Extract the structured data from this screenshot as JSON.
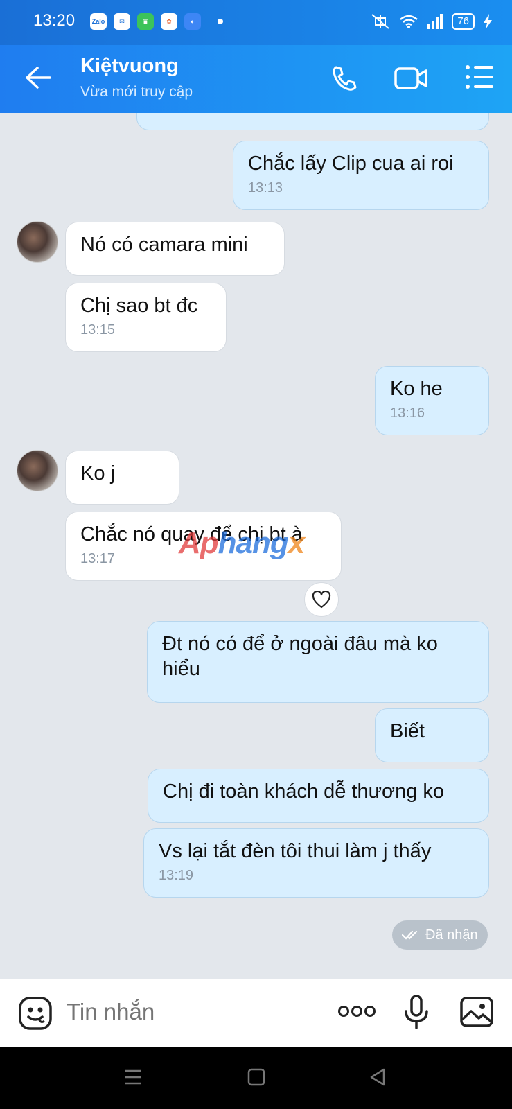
{
  "status_bar": {
    "time": "13:20",
    "apps": [
      "Zalo",
      "Messenger",
      "App",
      "Photos",
      "App"
    ],
    "battery": "76"
  },
  "header": {
    "name": "Kiệtvuong",
    "status": "Vừa mới truy cập"
  },
  "messages": [
    {
      "side": "out",
      "text": "Chắc lấy Clip cua ai roi",
      "time": "13:13"
    },
    {
      "side": "in",
      "text": "Nó có camara mini",
      "time": ""
    },
    {
      "side": "in",
      "text": "Chị sao bt đc",
      "time": "13:15"
    },
    {
      "side": "out",
      "text": "Ko he",
      "time": "13:16"
    },
    {
      "side": "in",
      "text": "Ko j",
      "time": ""
    },
    {
      "side": "in",
      "text": "Chắc nó quay để chị bt à",
      "time": "13:17"
    },
    {
      "side": "out",
      "text": "Đt nó có để ở ngoài đâu mà ko hiểu",
      "time": ""
    },
    {
      "side": "out",
      "text": "Biết",
      "time": ""
    },
    {
      "side": "out",
      "text": "Chị đi toàn khách dễ thương ko",
      "time": ""
    },
    {
      "side": "out",
      "text": "Vs lại tắt đèn tôi thui làm j thấy",
      "time": "13:19"
    }
  ],
  "received_label": "Đã nhận",
  "watermark": {
    "a": "Ap",
    "b": "hang",
    "c": "x"
  },
  "composer": {
    "placeholder": "Tin nhắn"
  },
  "colors": {
    "header": "#1f7df0",
    "outgoing_bubble": "#d8efff",
    "incoming_bubble": "#ffffff",
    "background": "#e3e7ec"
  }
}
